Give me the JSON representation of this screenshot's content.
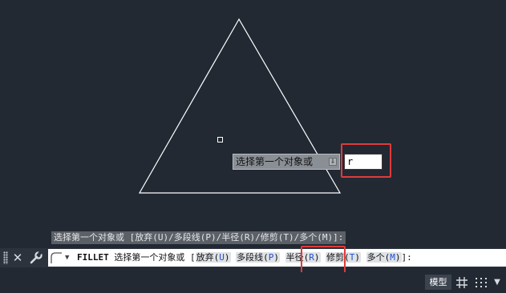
{
  "tooltip": {
    "prompt": "选择第一个对象或",
    "arrow_icon": "down-arrow-icon"
  },
  "dynamic_input": {
    "value": "r"
  },
  "history_line": "选择第一个对象或 [放弃(U)/多段线(P)/半径(R)/修剪(T)/多个(M)]:",
  "command_line": {
    "command_name": "FILLET",
    "prompt": "选择第一个对象或 [",
    "options": [
      {
        "label": "放弃(",
        "key": "U",
        "close": ")"
      },
      {
        "label": "多段线(",
        "key": "P",
        "close": ")"
      },
      {
        "label": "半径(",
        "key": "R",
        "close": ")"
      },
      {
        "label": "修剪(",
        "key": "T",
        "close": ")"
      },
      {
        "label": "多个(",
        "key": "M",
        "close": ")"
      }
    ],
    "suffix": "]:"
  },
  "status_bar": {
    "model_tab": "模型"
  },
  "colors": {
    "background": "#222933",
    "highlight": "#e03b3b",
    "option_key": "#1d4fd6"
  }
}
